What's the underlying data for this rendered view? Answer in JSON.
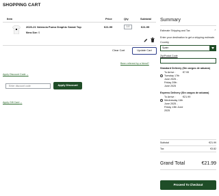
{
  "page": {
    "title": "SHOPPING CART"
  },
  "cart": {
    "headers": {
      "item": "Item",
      "price": "Price",
      "qty": "Qty",
      "subtotal": "Subtotal"
    },
    "item": {
      "name": "2020-21 Valencia Puma Graphic Sweat Top",
      "size_label": "Mens Size:",
      "size_value": "S",
      "price": "€21.99",
      "qty": "1.0",
      "subtotal": "€21.99"
    },
    "clear_label": "Clear Cart",
    "update_label": "Update Cart",
    "referred_label": "Been referred by a friend?"
  },
  "discount": {
    "link_label": "Apply Discount Code",
    "input_placeholder": "Enter discount code",
    "button_label": "Apply Discount"
  },
  "gift": {
    "link_label": "Apply Gift Card"
  },
  "summary": {
    "title": "Summary",
    "estimate_label": "Estimate Shipping and Tax",
    "estimate_message": "Enter your destination to get a shipping estimate.",
    "country_label": "Country",
    "country_value": "Spain",
    "zip_label": "Zip/Postal Code",
    "shipping": [
      {
        "heading": "Standard Delivery (Sin cargos de aduana)",
        "arrive": "To Arrive :",
        "price": "€7.99",
        "dates": [
          "Tuesday 17th",
          "June 2025 -",
          "Friday 20th",
          "June 2025"
        ]
      },
      {
        "heading": "Express Delivery (Sin cargos de aduana)",
        "arrive": "To Arrive :",
        "price": "€21.99",
        "dates": [
          "Wednesday 11th",
          "June 2025 -",
          "Friday 13th June",
          "2025"
        ]
      }
    ],
    "subtotal_label": "Subtotal",
    "subtotal_value": "€21.99",
    "tax_label": "Tax",
    "tax_value": "€3.82",
    "grand_label": "Grand Total",
    "grand_value": "€21.99",
    "checkout_label": "Proceed To Checkout"
  },
  "colors": {
    "accent": "#1f4d27",
    "link": "#2e6b2f",
    "update_border": "#2b3b88"
  }
}
